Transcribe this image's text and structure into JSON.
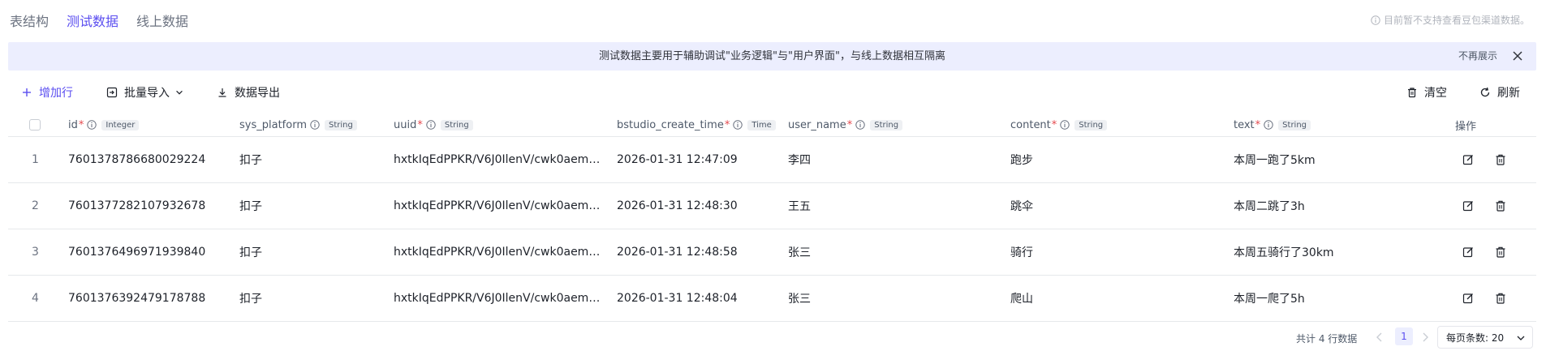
{
  "tabs": [
    {
      "label": "表结构",
      "active": false
    },
    {
      "label": "测试数据",
      "active": true
    },
    {
      "label": "线上数据",
      "active": false
    }
  ],
  "top_note": "目前暂不支持查看豆包渠道数据。",
  "banner": {
    "text": "测试数据主要用于辅助调试\"业务逻辑\"与\"用户界面\"，与线上数据相互隔离",
    "dismiss_label": "不再展示"
  },
  "toolbar": {
    "add_row": "增加行",
    "bulk_import": "批量导入",
    "export": "数据导出",
    "clear": "清空",
    "refresh": "刷新"
  },
  "columns": [
    {
      "name": "id",
      "type": "Integer"
    },
    {
      "name": "sys_platform",
      "type": "String"
    },
    {
      "name": "uuid",
      "type": "String"
    },
    {
      "name": "bstudio_create_time",
      "type": "Time"
    },
    {
      "name": "user_name",
      "type": "String"
    },
    {
      "name": "content",
      "type": "String"
    },
    {
      "name": "text",
      "type": "String"
    }
  ],
  "required_mark": "*",
  "actions_header": "操作",
  "rows": [
    {
      "num": "1",
      "id": "7601378786680029224",
      "sys_platform": "扣子",
      "uuid": "hxtkIqEdPPKR/V6J0IlenV/cwk0aem3…",
      "create_time": "2026-01-31 12:47:09",
      "user_name": "李四",
      "content": "跑步",
      "text": "本周一跑了5km"
    },
    {
      "num": "2",
      "id": "7601377282107932678",
      "sys_platform": "扣子",
      "uuid": "hxtkIqEdPPKR/V6J0IlenV/cwk0aem3…",
      "create_time": "2026-01-31 12:48:30",
      "user_name": "王五",
      "content": "跳伞",
      "text": "本周二跳了3h"
    },
    {
      "num": "3",
      "id": "7601376496971939840",
      "sys_platform": "扣子",
      "uuid": "hxtkIqEdPPKR/V6J0IlenV/cwk0aem3…",
      "create_time": "2026-01-31 12:48:58",
      "user_name": "张三",
      "content": "骑行",
      "text": "本周五骑行了30km"
    },
    {
      "num": "4",
      "id": "7601376392479178788",
      "sys_platform": "扣子",
      "uuid": "hxtkIqEdPPKR/V6J0IlenV/cwk0aem3…",
      "create_time": "2026-01-31 12:48:04",
      "user_name": "张三",
      "content": "爬山",
      "text": "本周一爬了5h"
    }
  ],
  "pagination": {
    "total": "共计 4 行数据",
    "current_page": "1",
    "page_size": "每页条数: 20"
  },
  "colors": {
    "accent": "#5b4ef0",
    "banner_bg": "#eceefe",
    "required": "#e5484d"
  }
}
